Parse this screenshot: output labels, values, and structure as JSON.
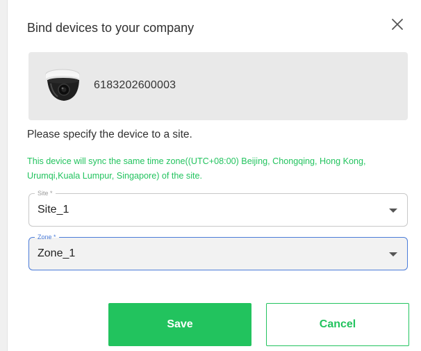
{
  "dialog": {
    "title": "Bind devices to your company",
    "device": {
      "serial": "6183202600003",
      "icon": "dome-camera-icon"
    },
    "instruction": "Please specify the device to a site.",
    "timezone_note": "This device will sync the same time zone((UTC+08:00) Beijing, Chongqing, Hong Kong, Urumqi,Kuala Lumpur, Singapore) of the site.",
    "site_field": {
      "label": "Site *",
      "value": "Site_1"
    },
    "zone_field": {
      "label": "Zone *",
      "value": "Zone_1"
    },
    "buttons": {
      "save": "Save",
      "cancel": "Cancel"
    }
  },
  "colors": {
    "accent": "#22c35e",
    "focus_border": "#4a7bd8",
    "card_bg": "#e9e9e9"
  }
}
